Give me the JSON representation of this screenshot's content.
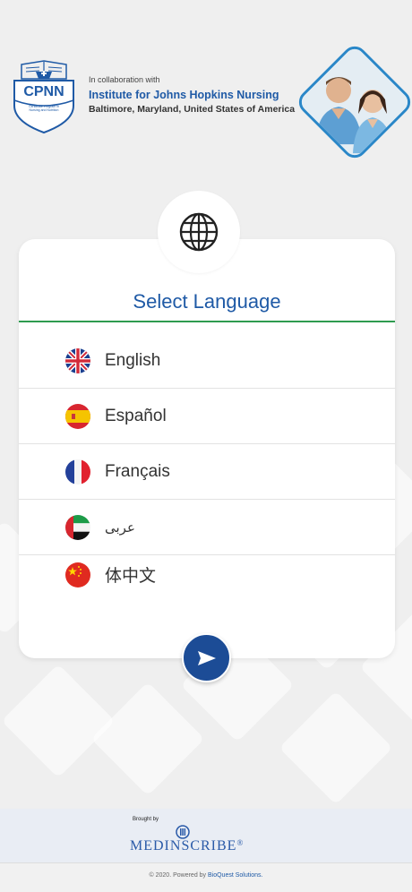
{
  "header": {
    "logo_text": "CPNN",
    "logo_subtext": "Certificate Program in Nursing and Nutrition",
    "collab_intro": "In collaboration with",
    "institute": "Institute for Johns Hopkins Nursing",
    "location": "Baltimore, Maryland, United States of America"
  },
  "card": {
    "title": "Select Language",
    "languages": [
      {
        "label": "English",
        "flag": "uk-flag-icon"
      },
      {
        "label": "Español",
        "flag": "spain-flag-icon"
      },
      {
        "label": "Français",
        "flag": "france-flag-icon"
      },
      {
        "label": "عربى",
        "flag": "uae-flag-icon"
      },
      {
        "label": "体中文",
        "flag": "china-flag-icon"
      }
    ]
  },
  "colors": {
    "accent_blue": "#1f5aa6",
    "accent_green": "#2e9b4f",
    "button_blue": "#1c4c96"
  },
  "footer": {
    "brought_by": "Brought by",
    "brand": "MEDINSCRIBE",
    "brand_mark": "®",
    "copyright_prefix": "© 2020. Powered by ",
    "powered_by": "BioQuest Solutions."
  }
}
